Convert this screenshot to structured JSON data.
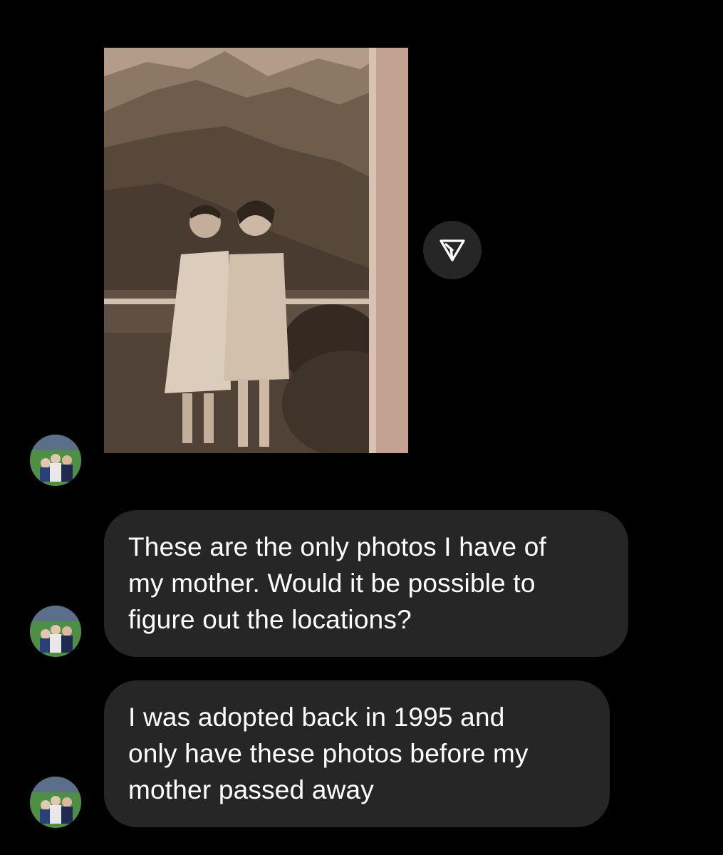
{
  "thread": {
    "messages": [
      {
        "type": "shared-photo",
        "sender_avatar": "profile-photo-icon",
        "action_icon": "send-icon"
      },
      {
        "type": "text",
        "text": "These are the only photos I have of\nmy mother.  Would it be possible to\nfigure out the locations?"
      },
      {
        "type": "text",
        "text": "I was adopted back in 1995 and\nonly have these photos before my\nmother passed away"
      }
    ]
  },
  "colors": {
    "background": "#000000",
    "bubble": "#262626",
    "text": "#ffffff",
    "photo_sepia": "#8a7460"
  }
}
